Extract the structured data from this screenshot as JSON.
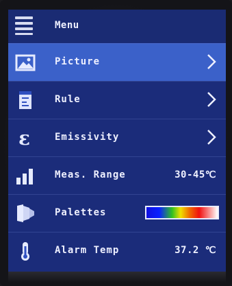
{
  "header": {
    "title": "Menu"
  },
  "menu": {
    "items": [
      {
        "label": "Picture"
      },
      {
        "label": "Rule"
      },
      {
        "label": "Emissivity"
      },
      {
        "label": "Meas. Range",
        "value": "30-45℃"
      },
      {
        "label": "Palettes"
      },
      {
        "label": "Alarm Temp",
        "value": "37.2 ℃"
      }
    ],
    "selected_index": 0
  },
  "colors": {
    "background": "#1b2c7a",
    "selected_row": "#3b61c9",
    "text": "#eef0ff"
  },
  "icons": [
    "menu-icon",
    "picture-icon",
    "ruler-icon",
    "epsilon-icon",
    "signal-bars-icon",
    "palette-fan-icon",
    "thermometer-icon",
    "chevron-right-icon"
  ]
}
